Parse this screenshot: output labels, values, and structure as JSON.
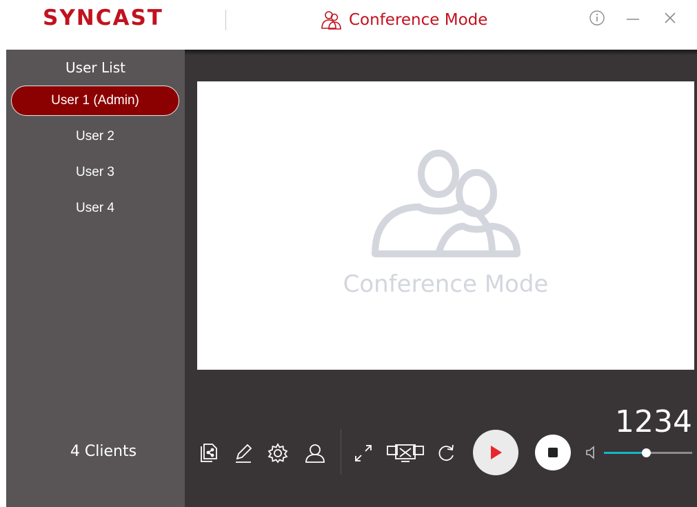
{
  "app": {
    "logo_text": "SYNCAST",
    "mode_title": "Conference Mode",
    "brand_color": "#c1121f",
    "window_controls": [
      "info-icon",
      "minimize-icon",
      "close-icon"
    ]
  },
  "sidebar": {
    "title": "User List",
    "users": [
      {
        "label": "User 1 (Admin)",
        "selected": true
      },
      {
        "label": "User 2",
        "selected": false
      },
      {
        "label": "User 3",
        "selected": false
      },
      {
        "label": "User 4",
        "selected": false
      }
    ],
    "clients_label": "4 Clients",
    "selected_color": "#8b0000"
  },
  "preview": {
    "placeholder_label": "Conference Mode",
    "placeholder_icon": "users-icon"
  },
  "toolbar": {
    "tools": [
      "share-file-icon",
      "pen-icon",
      "settings-icon",
      "user-icon",
      "expand-icon",
      "screen-off-icon",
      "refresh-icon"
    ],
    "play_icon": "play-icon",
    "stop_icon": "stop-icon",
    "code": "1234",
    "volume": {
      "icon": "volume-icon",
      "level": 0.48,
      "color": "#18b5c9"
    }
  }
}
